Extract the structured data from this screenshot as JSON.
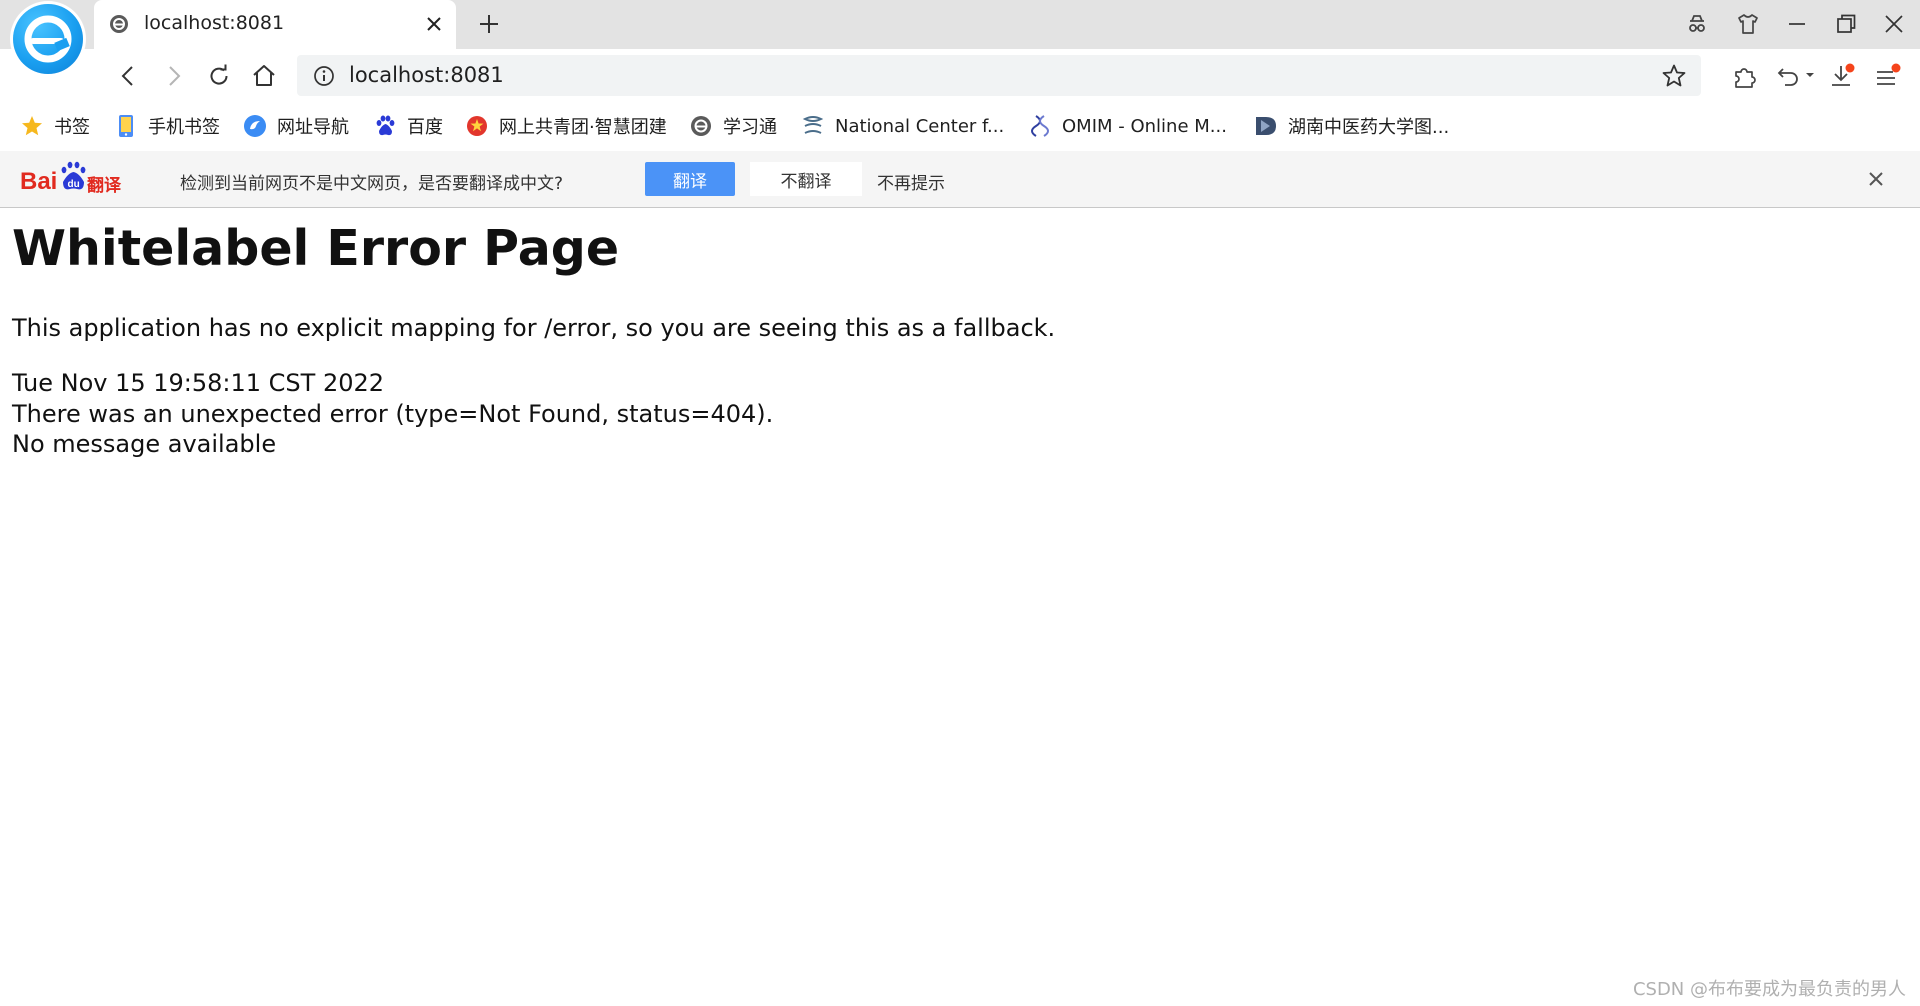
{
  "tab": {
    "title": "localhost:8081"
  },
  "address_bar": {
    "url": "localhost:8081"
  },
  "bookmarks": [
    {
      "label": "书签",
      "icon": "star-icon"
    },
    {
      "label": "手机书签",
      "icon": "phone-icon"
    },
    {
      "label": "网址导航",
      "icon": "navigation-icon"
    },
    {
      "label": "百度",
      "icon": "baidu-paw-icon"
    },
    {
      "label": "网上共青团·智慧团建",
      "icon": "youth-league-icon"
    },
    {
      "label": "学习通",
      "icon": "xuexitong-icon"
    },
    {
      "label": "National Center f...",
      "icon": "ncbi-icon"
    },
    {
      "label": "OMIM - Online M...",
      "icon": "dna-icon"
    },
    {
      "label": "湖南中医药大学图...",
      "icon": "library-icon"
    }
  ],
  "translate_bar": {
    "logo_text": "Bai翻译",
    "message": "检测到当前网页不是中文网页，是否要翻译成中文?",
    "translate_label": "翻译",
    "no_translate_label": "不翻译",
    "never_label": "不再提示"
  },
  "page": {
    "heading": "Whitelabel Error Page",
    "explanation": "This application has no explicit mapping for /error, so you are seeing this as a fallback.",
    "timestamp": "Tue Nov 15 19:58:11 CST 2022",
    "error_line": "There was an unexpected error (type=Not Found, status=404).",
    "message_line": "No message available"
  },
  "watermark": "CSDN @布布要成为最负责的男人",
  "colors": {
    "accent": "#4b93f7",
    "tabstrip": "#e3e3e3",
    "omnibox": "#f1f3f4",
    "notification_badge": "#f5441b"
  }
}
